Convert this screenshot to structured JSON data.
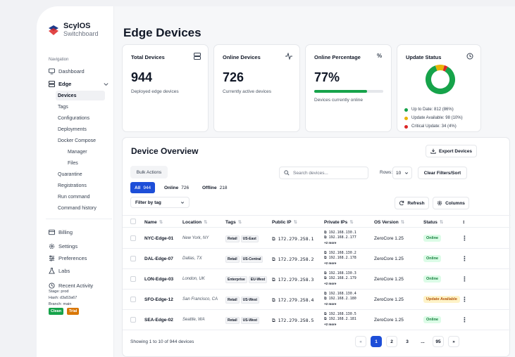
{
  "brand": {
    "name": "ScylOS",
    "sub": "Switchboard"
  },
  "sidebar": {
    "section": "Navigation",
    "dashboard": "Dashboard",
    "edge": "Edge",
    "sub": [
      "Devices",
      "Tags",
      "Configurations",
      "Deployments",
      "Docker Compose"
    ],
    "docker": [
      "Manager",
      "Files"
    ],
    "sub2": [
      "Quarantine",
      "Registrations",
      "Run command",
      "Command history"
    ],
    "billing": "Billing",
    "settings": "Settings",
    "preferences": "Preferences",
    "labs": "Labs",
    "recent": "Recent Activity",
    "stage": "Stage: prod",
    "hash": "Hash: d3a53a67",
    "branch": "Branch: main",
    "clean": "Clean",
    "trial": "Trial"
  },
  "page": {
    "title": "Edge Devices"
  },
  "cards": {
    "total": {
      "title": "Total Devices",
      "value": "944",
      "sub": "Deployed edge devices"
    },
    "online": {
      "title": "Online Devices",
      "value": "726",
      "sub": "Currently active devices"
    },
    "percent": {
      "title": "Online Percentage",
      "value": "77%",
      "sub": "Devices currently online",
      "fill": 77,
      "icon": "%"
    },
    "status": {
      "title": "Update Status",
      "legend": [
        "Up to Date: 812 (86%)",
        "Update Available: 98 (10%)",
        "Critical Update: 34 (4%)"
      ],
      "colors": [
        "#16a34a",
        "#eab308",
        "#dc2626"
      ],
      "values": [
        86,
        10,
        4
      ]
    }
  },
  "overview": {
    "title": "Device Overview",
    "export": "Export Devices",
    "bulk": "Bulk Actions",
    "search_placeholder": "Search devices...",
    "rows_label": "Rows:",
    "rows_value": "10",
    "clear": "Clear Filters/Sort",
    "tabs": [
      {
        "label": "All",
        "count": "944"
      },
      {
        "label": "Online",
        "count": "726"
      },
      {
        "label": "Offline",
        "count": "218"
      }
    ],
    "filter_tag": "Filter by tag",
    "refresh": "Refresh",
    "columns_btn": "Columns",
    "headers": [
      "Name",
      "Location",
      "Tags",
      "Public IP",
      "Private IPs",
      "OS Version",
      "Status"
    ],
    "more": "+2 more",
    "rows": [
      {
        "name": "NYC-Edge-01",
        "loc": "New York, NY",
        "tags": [
          "Retail",
          "US-East"
        ],
        "ip": "172.279.258.1",
        "p1": "192.168.130.1",
        "p2": "192.168.2.177",
        "os": "ZeroCore 1.25",
        "status": "Online"
      },
      {
        "name": "DAL-Edge-07",
        "loc": "Dallas, TX",
        "tags": [
          "Retail",
          "US-Central"
        ],
        "ip": "172.279.258.2",
        "p1": "192.168.130.2",
        "p2": "192.168.2.178",
        "os": "ZeroCore 1.25",
        "status": "Online"
      },
      {
        "name": "LON-Edge-03",
        "loc": "London, UK",
        "tags": [
          "Enterprise",
          "EU-West"
        ],
        "ip": "172.279.258.3",
        "p1": "192.168.130.3",
        "p2": "192.168.2.179",
        "os": "ZeroCore 1.25",
        "status": "Online"
      },
      {
        "name": "SFO-Edge-12",
        "loc": "San Francisco, CA",
        "tags": [
          "Retail",
          "US-West"
        ],
        "ip": "172.279.258.4",
        "p1": "192.168.130.4",
        "p2": "192.168.2.180",
        "os": "ZeroCore 1.25",
        "status": "Update Available"
      },
      {
        "name": "SEA-Edge-02",
        "loc": "Seattle, WA",
        "tags": [
          "Retail",
          "US-West"
        ],
        "ip": "172.279.258.5",
        "p1": "192.168.130.5",
        "p2": "192.168.2.181",
        "os": "ZeroCore 1.25",
        "status": "Online"
      }
    ],
    "footer": "Showing 1 to 10 of 944 devices",
    "pages": [
      "«",
      "1",
      "2",
      "3",
      "...",
      "95",
      "»"
    ]
  }
}
